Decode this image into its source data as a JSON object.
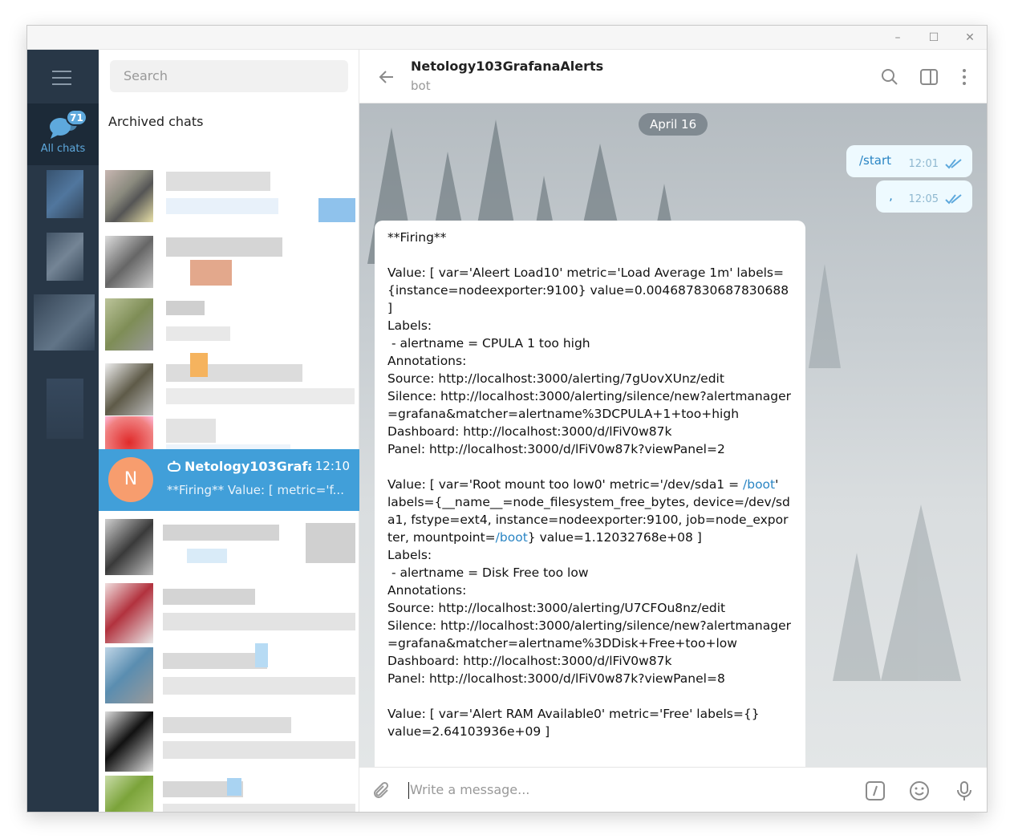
{
  "window": {
    "controls": [
      "–",
      "☐",
      "✕"
    ]
  },
  "rail": {
    "all_chats_label": "All chats",
    "badge": "71"
  },
  "sidebar": {
    "search_placeholder": "Search",
    "archived_label": "Archived chats",
    "active_chat": {
      "avatar": "N",
      "name": "Netology103Grafa...",
      "time": "12:10",
      "preview": "**Firing**  Value: [ metric='f..."
    }
  },
  "chat": {
    "title": "Netology103GrafanaAlerts",
    "subtitle": "bot",
    "date": "April 16",
    "outgoing": [
      {
        "text": "/start",
        "time": "12:01"
      },
      {
        "text": "‚",
        "time": "12:05"
      }
    ],
    "compose_placeholder": "Write a message..."
  },
  "message": {
    "line1": "**Firing**",
    "block1": "Value: [ var='Aleert Load10' metric='Load Average 1m' labels={instance=nodeexporter:9100} value=0.004687830687830688 ]\nLabels:\n - alertname = CPULA 1 too high\nAnnotations:\nSource: http://localhost:3000/alerting/7gUovXUnz/edit\nSilence: http://localhost:3000/alerting/silence/new?alertmanager=grafana&matcher=alertname%3DCPULA+1+too+high\nDashboard: http://localhost:3000/d/lFiV0w87k\nPanel: http://localhost:3000/d/lFiV0w87k?viewPanel=2",
    "block2a": "Value: [ var='Root mount too low0' metric='/dev/sda1 = ",
    "link_boot": "/boot",
    "block2b": "'\nlabels={__name__=node_filesystem_free_bytes, device=/dev/sda1, fstype=ext4, instance=nodeexporter:9100, job=node_exporter, mountpoint=",
    "block2c": "} value=1.12032768e+08 ]\nLabels:\n - alertname = Disk Free too low\nAnnotations:\nSource: http://localhost:3000/alerting/U7CFOu8nz/edit\nSilence: http://localhost:3000/alerting/silence/new?alertmanager=grafana&matcher=alertname%3DDisk+Free+too+low\nDashboard: http://localhost:3000/d/lFiV0w87k\nPanel: http://localhost:3000/d/lFiV0w87k?viewPanel=8",
    "block3": "Value: [ var='Alert RAM Available0' metric='Free' labels={}\nvalue=2.64103936e+09 ]"
  }
}
